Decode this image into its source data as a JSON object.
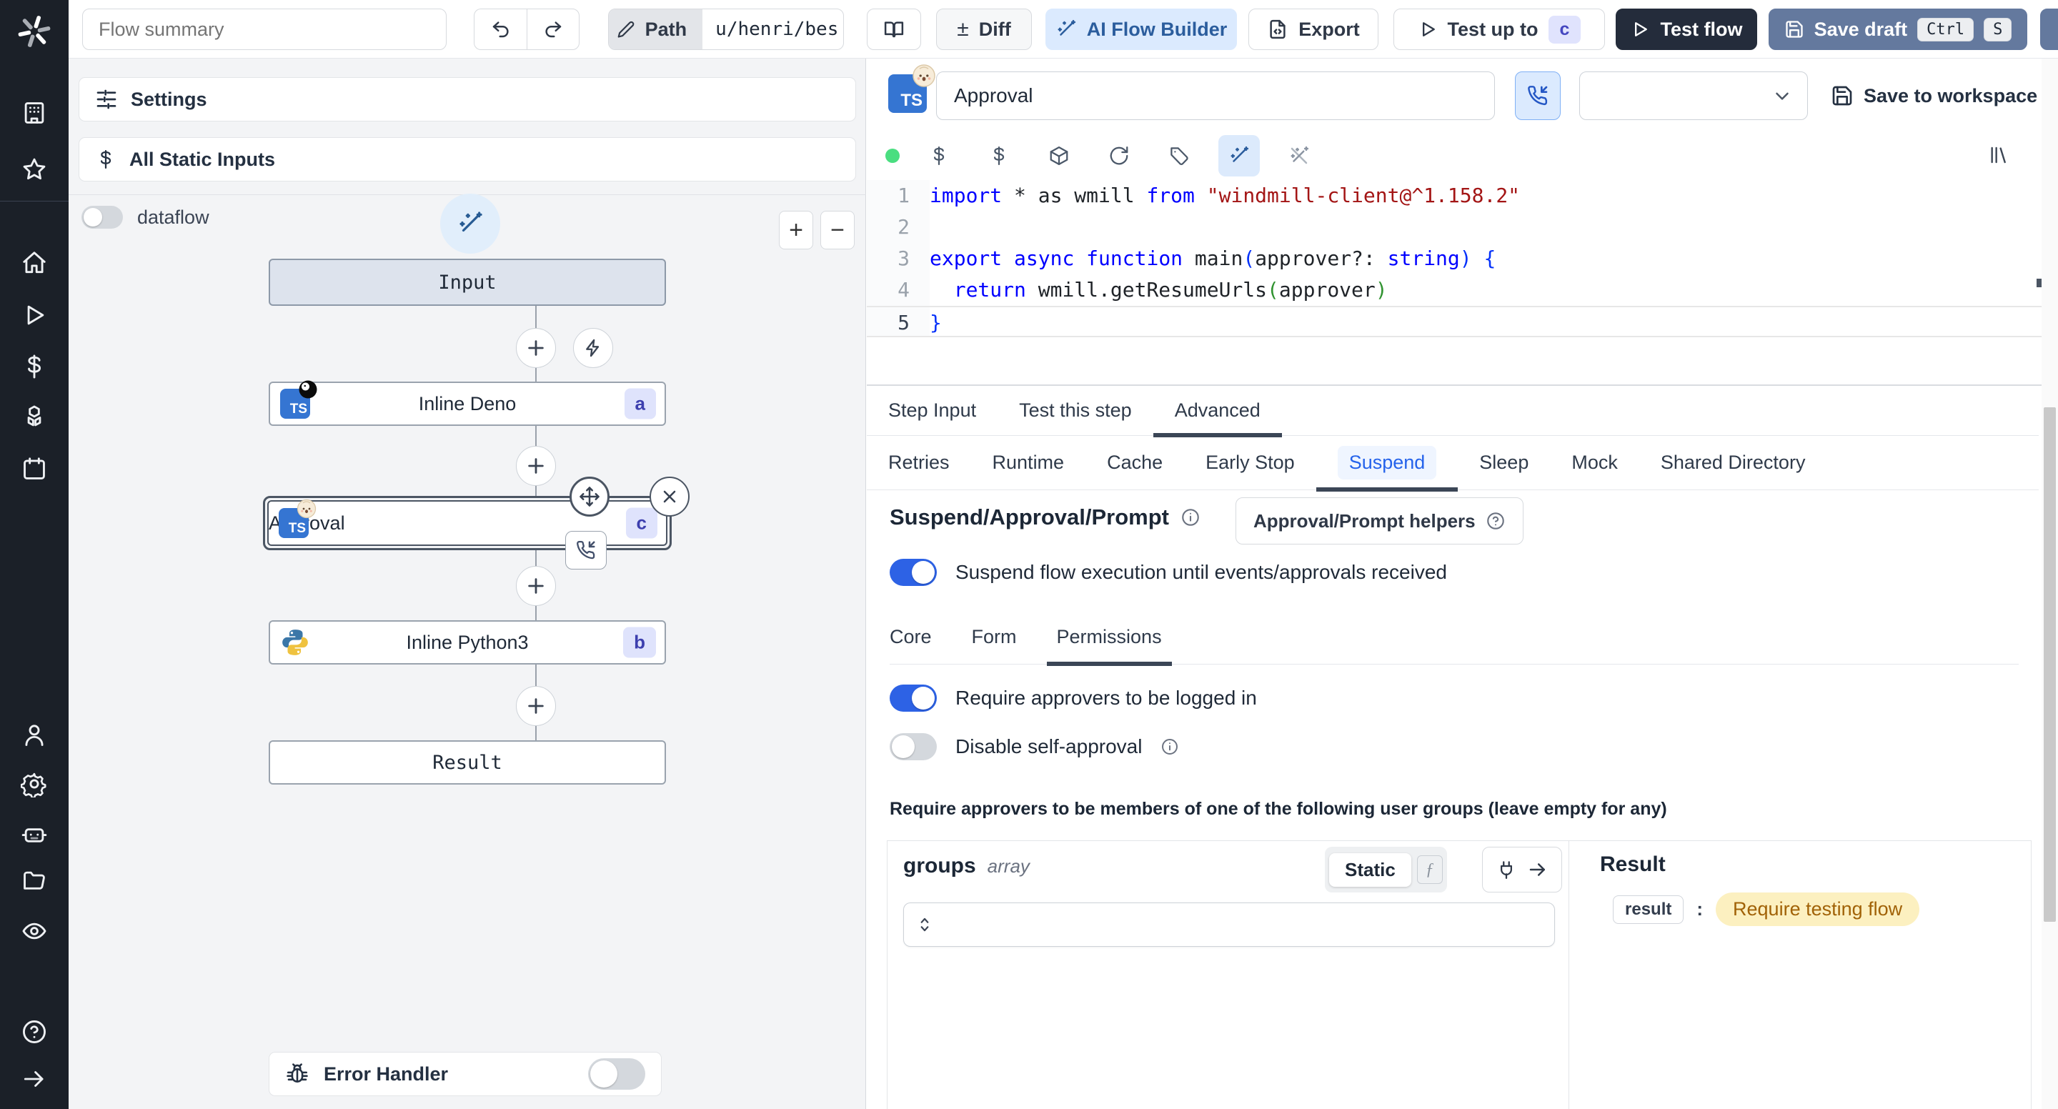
{
  "colors": {
    "accent_blue": "#2d62e5",
    "ai_button_bg": "#dbeafe",
    "dark_button": "#242c3b",
    "save_draft_bg": "#64799e",
    "badge_bg": "#dfe3fc",
    "badge_text": "#3d3fae",
    "amber_pill_bg": "#fcf0c0",
    "amber_pill_text": "#a16207",
    "sidebar_bg": "#1b2028"
  },
  "topbar": {
    "flow_summary_placeholder": "Flow summary",
    "path_label": "Path",
    "path_value": "u/henri/bes",
    "diff_sign": "±",
    "diff_label": "Diff",
    "ai_flow_builder_label": "AI Flow Builder",
    "export_label": "Export",
    "test_up_to_label": "Test up to",
    "test_up_to_badge": "c",
    "test_flow_label": "Test flow",
    "save_draft_label": "Save draft",
    "kbd_ctrl": "Ctrl",
    "kbd_s": "S"
  },
  "flow_panel": {
    "settings_label": "Settings",
    "static_inputs_label": "All Static Inputs",
    "dataflow_label": "dataflow",
    "zoom_in": "+",
    "zoom_out": "−",
    "nodes": {
      "input": {
        "label": "Input"
      },
      "deno": {
        "label": "Inline Deno",
        "badge": "a",
        "lang": "TS"
      },
      "approval": {
        "label": "Approval",
        "badge": "c",
        "lang": "TS"
      },
      "python": {
        "label": "Inline Python3",
        "badge": "b"
      },
      "result": {
        "label": "Result"
      }
    },
    "error_handler_label": "Error Handler"
  },
  "editor": {
    "title_value": "Approval",
    "lang_badge": "TS",
    "save_to_workspace_label": "Save to workspace",
    "code": {
      "lines": [
        {
          "n": "1",
          "tokens": [
            {
              "t": "import",
              "c": "kw"
            },
            {
              "t": " * as wmill ",
              "c": "pl"
            },
            {
              "t": "from",
              "c": "kw"
            },
            {
              "t": " ",
              "c": "pl"
            },
            {
              "t": "\"windmill-client@^1.158.2\"",
              "c": "str"
            }
          ]
        },
        {
          "n": "2",
          "tokens": []
        },
        {
          "n": "3",
          "tokens": [
            {
              "t": "export",
              "c": "kw"
            },
            {
              "t": " ",
              "c": "pl"
            },
            {
              "t": "async",
              "c": "kw"
            },
            {
              "t": " ",
              "c": "pl"
            },
            {
              "t": "function",
              "c": "kw"
            },
            {
              "t": " main",
              "c": "pl"
            },
            {
              "t": "(",
              "c": "b1"
            },
            {
              "t": "approver?: ",
              "c": "pl"
            },
            {
              "t": "string",
              "c": "kw"
            },
            {
              "t": ")",
              "c": "b1"
            },
            {
              "t": " {",
              "c": "b1"
            }
          ]
        },
        {
          "n": "4",
          "tokens": [
            {
              "t": "  ",
              "c": "pl"
            },
            {
              "t": "return",
              "c": "kw"
            },
            {
              "t": " wmill.getResumeUrls",
              "c": "pl"
            },
            {
              "t": "(",
              "c": "b2"
            },
            {
              "t": "approver",
              "c": "pl"
            },
            {
              "t": ")",
              "c": "b2"
            }
          ]
        },
        {
          "n": "5",
          "active": true,
          "tokens": [
            {
              "t": "}",
              "c": "b1"
            }
          ]
        }
      ]
    }
  },
  "tabs": {
    "step": [
      "Step Input",
      "Test this step",
      "Advanced"
    ],
    "advanced": [
      "Retries",
      "Runtime",
      "Cache",
      "Early Stop",
      "Suspend",
      "Sleep",
      "Mock",
      "Shared Directory"
    ]
  },
  "suspend": {
    "heading": "Suspend/Approval/Prompt",
    "helpers_button_label": "Approval/Prompt helpers",
    "suspend_toggle_label": "Suspend flow execution until events/approvals received",
    "subtabs": [
      "Core",
      "Form",
      "Permissions"
    ],
    "require_login_label": "Require approvers to be logged in",
    "disable_self_approval_label": "Disable self-approval",
    "groups_note": "Require approvers to be members of one of the following user groups (leave empty for any)",
    "groups": {
      "name": "groups",
      "type": "array",
      "static_label": "Static",
      "fx_label": "ƒ"
    },
    "result": {
      "title": "Result",
      "key": "result",
      "value": "Require testing flow"
    }
  }
}
